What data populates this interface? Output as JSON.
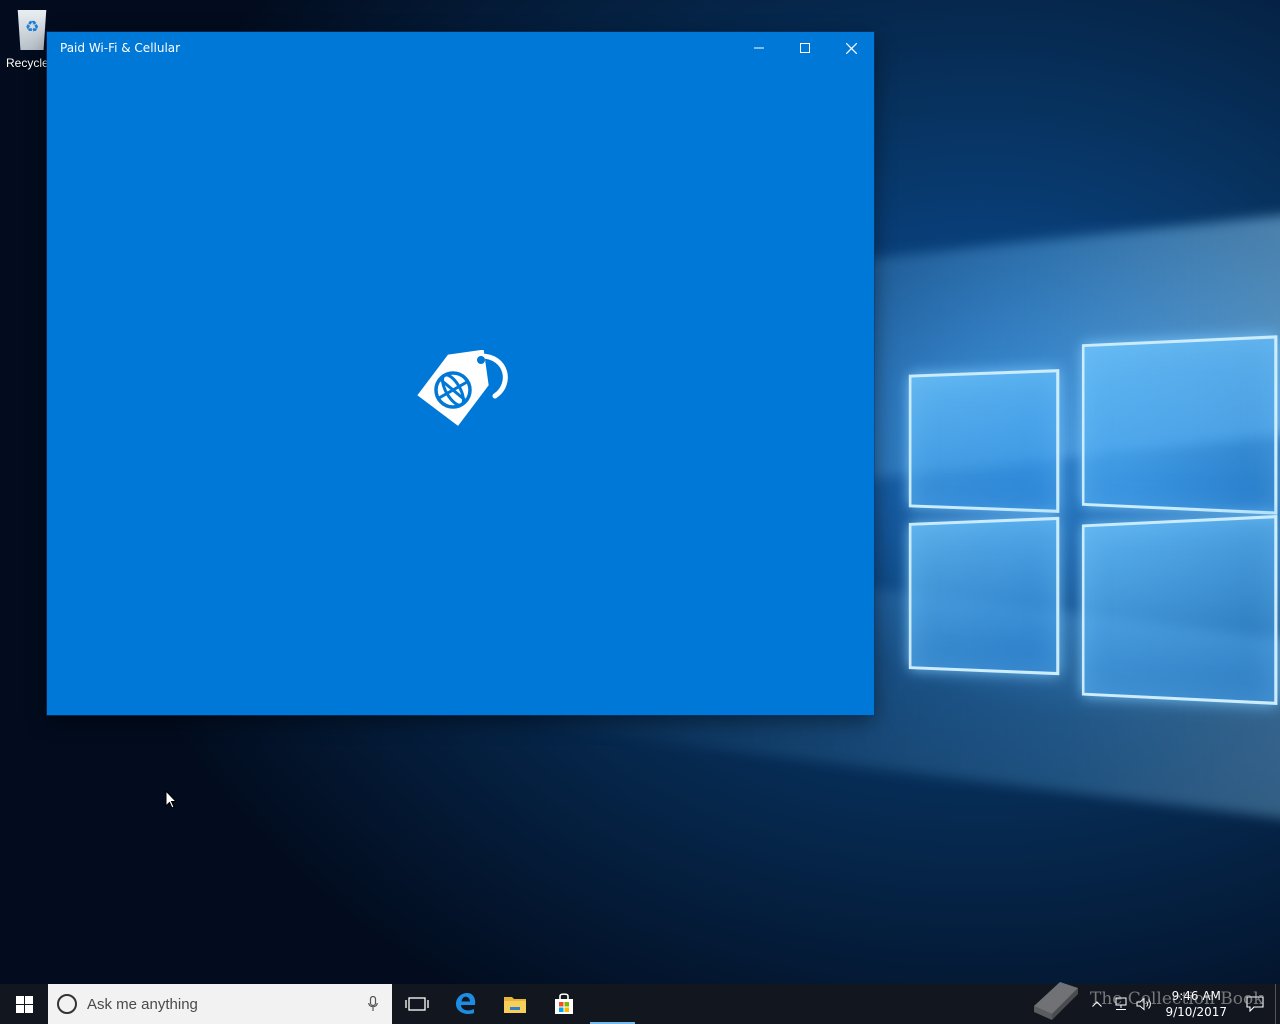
{
  "desktop": {
    "icons": [
      {
        "label": "Recycle Bin",
        "icon": "recycle-bin-icon"
      }
    ]
  },
  "window": {
    "title": "Paid Wi-Fi & Cellular",
    "buttons": {
      "minimize": "minimize-icon",
      "maximize": "maximize-icon",
      "close": "close-icon"
    },
    "splash_icon": "paid-wifi-tag-globe-icon",
    "background": "#0078d7"
  },
  "taskbar": {
    "search_placeholder": "Ask me anything",
    "pinned": [
      {
        "name": "task-view",
        "icon": "task-view-icon"
      },
      {
        "name": "edge",
        "icon": "edge-icon"
      },
      {
        "name": "file-explorer",
        "icon": "folder-icon"
      },
      {
        "name": "store",
        "icon": "store-icon"
      },
      {
        "name": "paid-wifi-app",
        "icon": "app-active-indicator",
        "active": true
      }
    ],
    "clock": {
      "time": "9:46 AM",
      "date": "9/10/2017"
    }
  },
  "watermark": {
    "text": "The Collection Book"
  }
}
